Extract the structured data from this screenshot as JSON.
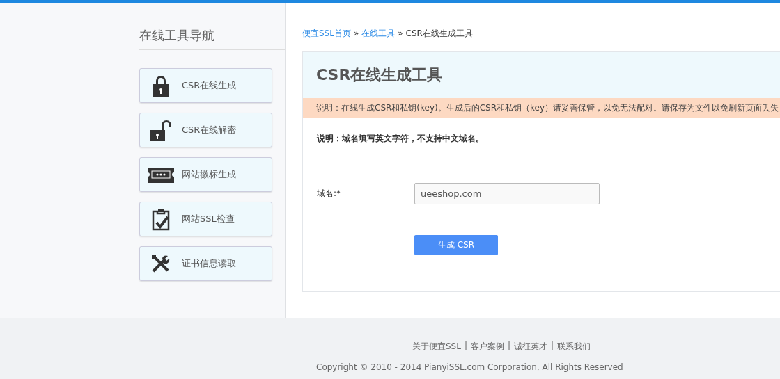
{
  "sidebar": {
    "title": "在线工具导航",
    "items": [
      {
        "label": "CSR在线生成"
      },
      {
        "label": "CSR在线解密"
      },
      {
        "label": "网站徽标生成"
      },
      {
        "label": "网站SSL检查"
      },
      {
        "label": "证书信息读取"
      }
    ]
  },
  "breadcrumb": [
    {
      "label": "便宜SSL首页",
      "kind": "link",
      "separator": "»"
    },
    {
      "label": "在线工具",
      "kind": "link",
      "separator": "»"
    },
    {
      "label": "CSR在线生成工具",
      "kind": "current"
    }
  ],
  "panel": {
    "title": "CSR在线生成工具",
    "notice": "说明：在线生成CSR和私钥(key)。生成后的CSR和私钥（key）请妥善保管，以免无法配对。请保存为文件以免刷新页面丢失",
    "hint": "说明：域名填写英文字符，不支持中文域名。",
    "field": {
      "label": "域名:*",
      "value": "ueeshop.com"
    },
    "button": "生成 CSR"
  },
  "footer": {
    "links": [
      {
        "label": "关于便宜SSL",
        "separator": "|"
      },
      {
        "label": "客户案例",
        "separator": "|"
      },
      {
        "label": "诚征英才",
        "separator": "|"
      },
      {
        "label": "联系我们"
      }
    ],
    "copyright": "Copyright © 2010 - 2014 PianyiSSL.com Corporation, All Rights Reserved"
  }
}
